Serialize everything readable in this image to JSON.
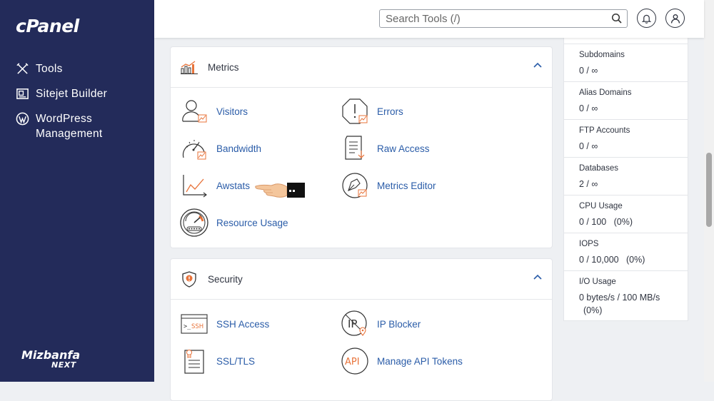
{
  "sidebar": {
    "logo": "cPanel",
    "items": [
      {
        "label": "Tools",
        "icon": "tools-icon"
      },
      {
        "label": "Sitejet Builder",
        "icon": "sitejet-icon"
      },
      {
        "label": "WordPress Management",
        "icon": "wordpress-icon"
      }
    ],
    "brand_line1": "Mizbanfa",
    "brand_line2": "NEXT"
  },
  "header": {
    "search_placeholder": "Search Tools (/)",
    "icons": [
      "search-icon",
      "bell-icon",
      "user-icon"
    ]
  },
  "metrics": {
    "title": "Metrics",
    "tools": {
      "visitors": "Visitors",
      "errors": "Errors",
      "bandwidth": "Bandwidth",
      "raw_access": "Raw Access",
      "awstats": "Awstats",
      "metrics_editor": "Metrics Editor",
      "resource_usage": "Resource Usage"
    }
  },
  "security": {
    "title": "Security",
    "tools": {
      "ssh_access": "SSH Access",
      "ip_blocker": "IP Blocker",
      "ssl_tls": "SSL/TLS",
      "manage_api_tokens": "Manage API Tokens"
    },
    "ssh_icon_text": ">_SSH",
    "api_icon_text": "API",
    "ip_icon_text": "IP"
  },
  "stats": [
    {
      "name": "Subdomains",
      "value": "0 / ∞"
    },
    {
      "name": "Alias Domains",
      "value": "0 / ∞"
    },
    {
      "name": "FTP Accounts",
      "value": "0 / ∞"
    },
    {
      "name": "Databases",
      "value": "2 / ∞"
    },
    {
      "name": "CPU Usage",
      "value": "0 / 100   (0%)"
    },
    {
      "name": "IOPS",
      "value": "0 / 10,000   (0%)"
    },
    {
      "name": "I/O Usage",
      "value": "0 bytes/s / 100 MB/s",
      "value2": "(0%)"
    }
  ],
  "colors": {
    "sidebar_bg": "#232b5a",
    "link": "#2a5ca8",
    "accent_orange": "#e8733a"
  }
}
